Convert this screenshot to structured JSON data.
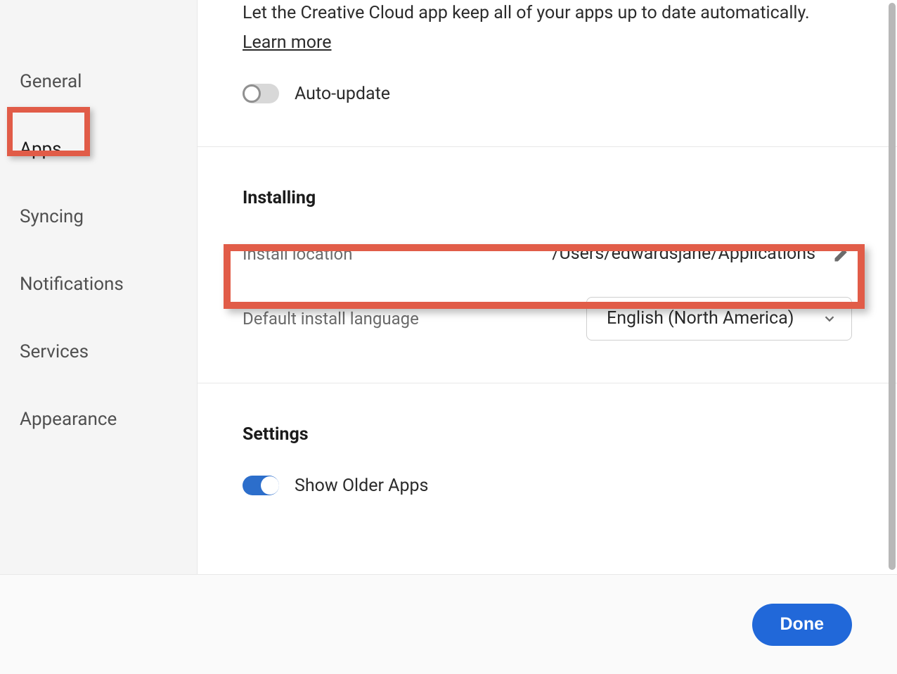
{
  "sidebar": {
    "items": [
      {
        "label": "General"
      },
      {
        "label": "Apps"
      },
      {
        "label": "Syncing"
      },
      {
        "label": "Notifications"
      },
      {
        "label": "Services"
      },
      {
        "label": "Appearance"
      }
    ]
  },
  "autoupdate": {
    "description": "Let the Creative Cloud app keep all of your apps up to date automatically.",
    "learn_more_label": "Learn more",
    "toggle_label": "Auto-update",
    "enabled": false
  },
  "installing": {
    "title": "Installing",
    "install_location_label": "Install location",
    "install_location_value": "/Users/edwardsjane/Applications",
    "default_language_label": "Default install language",
    "default_language_value": "English (North America)"
  },
  "settings": {
    "title": "Settings",
    "show_older_label": "Show Older Apps",
    "show_older_enabled": true
  },
  "footer": {
    "done_label": "Done"
  },
  "highlight": {
    "sidebar_active": "Apps",
    "row_highlighted": "install_location"
  }
}
